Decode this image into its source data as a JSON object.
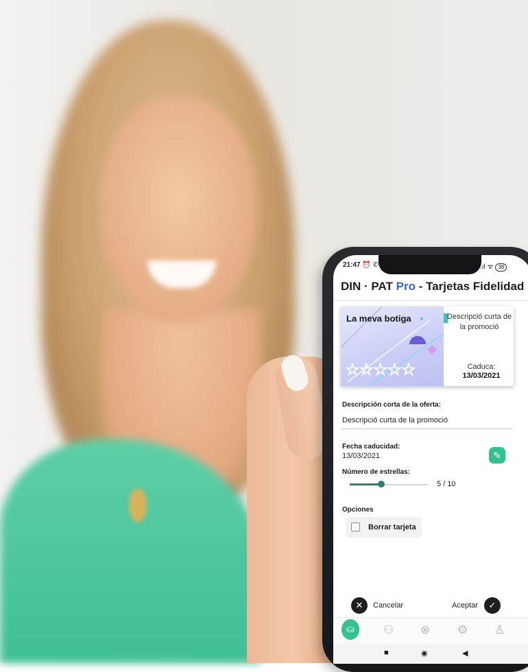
{
  "status_bar": {
    "time": "21:47",
    "left_icons": "⏰ ✆",
    "right_icons": ".ıl ᯤ",
    "battery": "38"
  },
  "header": {
    "brand": "DIN · PAT",
    "pro": "Pro",
    "separator": "-",
    "section": "Tarjetas Fidelidad"
  },
  "card": {
    "store_name": "La meva botiga",
    "description": "Descripció curta de la promoció",
    "expiry_label": "Caduca:",
    "expiry_date": "13/03/2021",
    "stars": "☆☆☆☆☆"
  },
  "form": {
    "description_label": "Descripción corta de la oferta:",
    "description_value": "Descripció curta de la promoció",
    "expiry_label": "Fecha caducidad:",
    "expiry_value": "13/03/2021",
    "stars_label": "Número de estrellas:",
    "stars_value": "5 / 10",
    "stars_fraction": 0.4,
    "options_label": "Opciones",
    "delete_label": "Borrar tarjeta"
  },
  "actions": {
    "cancel_label": "Cancelar",
    "accept_label": "Aceptar",
    "cancel_icon": "✕",
    "accept_icon": "✓"
  },
  "colors": {
    "accent": "#2fc28c",
    "pro_blue": "#3c64d6"
  },
  "bottom_nav": {
    "icons": [
      "basket-icon",
      "user-pin-icon",
      "circle-icon",
      "gear-icon",
      "person-icon"
    ]
  },
  "system_nav": {
    "square": "■",
    "home": "◉",
    "back": "◀"
  }
}
